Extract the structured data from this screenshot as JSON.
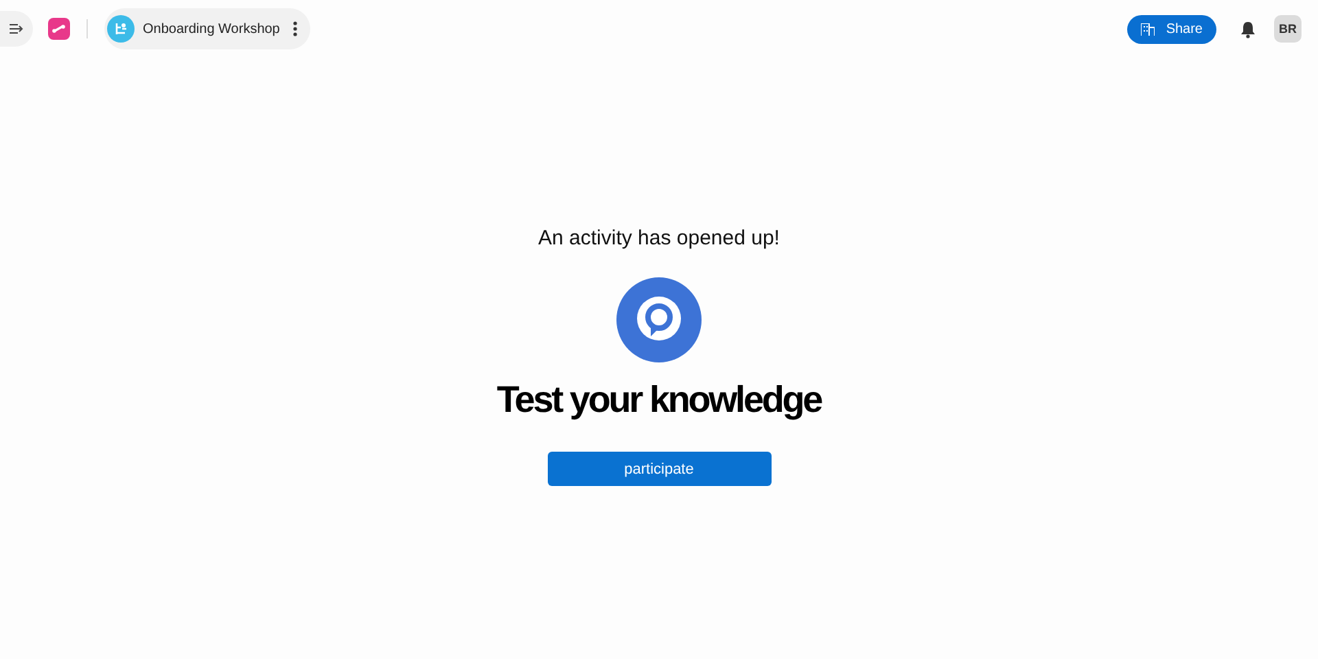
{
  "toolbar": {
    "board_title": "Onboarding Workshop",
    "share_label": "Share",
    "avatar_initials": "BR"
  },
  "activity": {
    "notice": "An activity has opened up!",
    "title": "Test your knowledge",
    "button_label": "participate"
  }
}
